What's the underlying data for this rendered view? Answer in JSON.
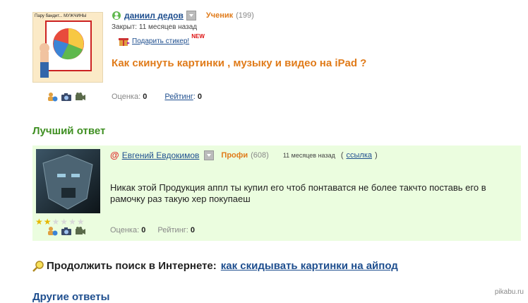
{
  "question": {
    "author": "даниил дедов",
    "rank": "Ученик",
    "rank_count": "(199)",
    "closed_label": "Закрыт:",
    "closed_time": "11 месяцев назад",
    "gift_sticker": "Подарить стикер!",
    "gift_badge": "NEW",
    "title": "Как скинуть картинки , музыку и видео на iPad ?",
    "score_label": "Оценка:",
    "score_value": "0",
    "rating_label": "Рейтинг",
    "rating_value": "0",
    "avatar_text": "Пару бандит... МУЖЧИНЫ"
  },
  "best_answer": {
    "heading": "Лучший ответ",
    "author": "Евгений Евдокимов",
    "rank": "Профи",
    "rank_count": "(608)",
    "time": "11 месяцев назад",
    "link_label": "ссылка",
    "text": "Никак этой Продукция аппл ты купил его чтоб понтаватся не более такчто поставь его в рамочку раз такую хер покупаеш",
    "score_label": "Оценка:",
    "score_value": "0",
    "rating_label": "Рейтинг:",
    "rating_value": "0",
    "stars_filled": 2,
    "stars_total": 6
  },
  "continue_search": {
    "label": "Продолжить поиск в Интернете:",
    "query": "как скидывать картинки на айпод"
  },
  "other_answers": {
    "heading": "Другие ответы"
  },
  "watermark": "pikabu.ru",
  "colors": {
    "orange": "#e07b1a",
    "link_blue": "#1f4f8f",
    "green_heading": "#3f8f22",
    "best_bg": "#ebfddf"
  }
}
